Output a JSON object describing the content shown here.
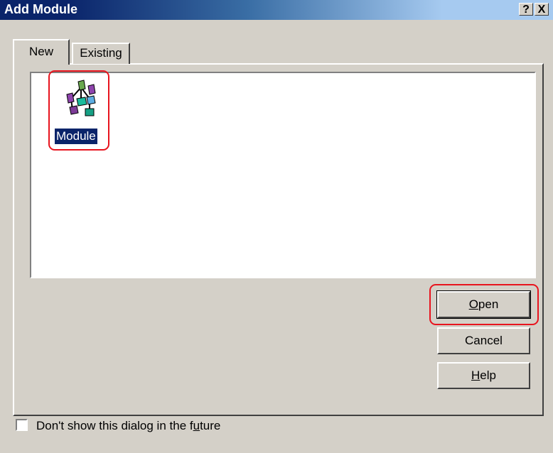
{
  "window": {
    "title": "Add Module",
    "help_button": "?",
    "close_button": "X"
  },
  "tabs": [
    {
      "label": "New",
      "active": true
    },
    {
      "label": "Existing",
      "active": false
    }
  ],
  "list": {
    "items": [
      {
        "label": "Module",
        "icon": "module-icon",
        "selected": true
      }
    ]
  },
  "buttons": {
    "open": {
      "label_prefix": "",
      "mnemonic": "O",
      "label_suffix": "pen"
    },
    "cancel": {
      "label": "Cancel"
    },
    "help": {
      "label_prefix": "",
      "mnemonic": "H",
      "label_suffix": "elp"
    }
  },
  "checkbox": {
    "label_prefix": "Don't show this dialog in the f",
    "mnemonic": "u",
    "label_suffix": "ture",
    "checked": false
  },
  "colors": {
    "title_gradient_start": "#0a246a",
    "title_gradient_end": "#a6caf0",
    "highlight": "#e8141e",
    "selection": "#0a246a",
    "dialog_bg": "#d4d0c8"
  }
}
